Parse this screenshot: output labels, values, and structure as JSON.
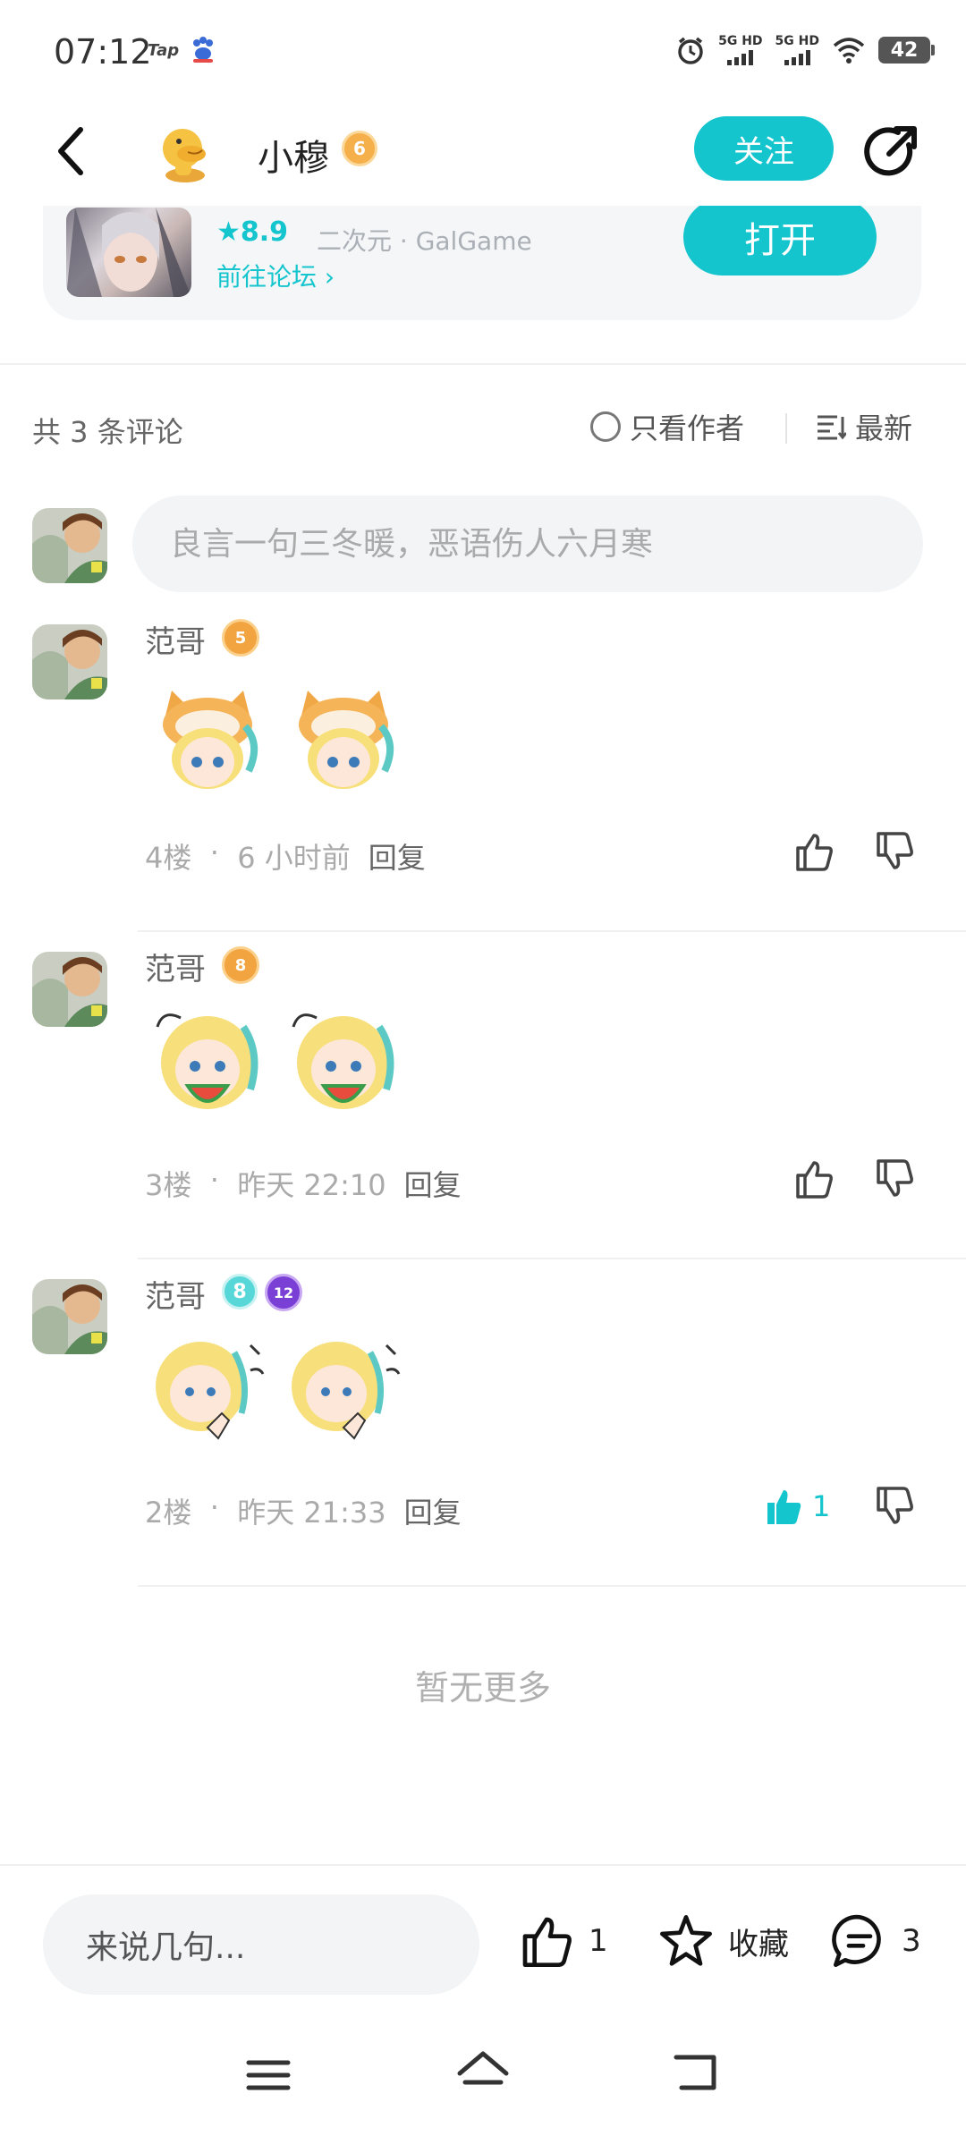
{
  "status_bar": {
    "time": "07:12",
    "app_icon_1": "Tap",
    "app_icon_2": "baidu-paw-icon",
    "net_1": "5G HD",
    "net_2": "5G HD",
    "battery": "42"
  },
  "header": {
    "author_name": "小穆",
    "author_level": "6",
    "follow_label": "关注"
  },
  "game": {
    "rating": "8.9",
    "tags": "二次元 · GalGame",
    "forum_link": "前往论坛",
    "open_label": "打开"
  },
  "comments_header": {
    "count_label": "共 3 条评论",
    "author_only_label": "只看作者",
    "sort_label": "最新"
  },
  "comment_input": {
    "placeholder": "良言一句三冬暖，恶语伤人六月寒"
  },
  "comments": [
    {
      "user": "范哥",
      "badge": "5",
      "floor": "4楼",
      "time": "6 小时前",
      "reply_label": "回复",
      "likes": ""
    },
    {
      "user": "范哥",
      "badge": "8",
      "floor": "3楼",
      "time": "昨天 22:10",
      "reply_label": "回复",
      "likes": ""
    },
    {
      "user": "范哥",
      "badge": "8",
      "badge2": "12",
      "floor": "2楼",
      "time": "昨天 21:33",
      "reply_label": "回复",
      "likes": "1"
    }
  ],
  "no_more": "暂无更多",
  "bottom_bar": {
    "input_placeholder": "来说几句...",
    "like_count": "1",
    "favorite_label": "收藏",
    "comment_count": "3"
  },
  "colors": {
    "accent": "#15c5ce",
    "badge_orange": "#f2a441",
    "badge_purple": "#7a3fd4"
  }
}
